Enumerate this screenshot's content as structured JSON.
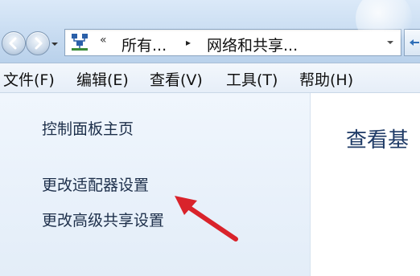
{
  "address_bar": {
    "overflow_chevron": "«",
    "crumbs": [
      "所有...",
      "网络和共享..."
    ],
    "separator": "▸"
  },
  "menu": {
    "file": "文件(F)",
    "edit": "编辑(E)",
    "view": "查看(V)",
    "tools": "工具(T)",
    "help": "帮助(H)"
  },
  "left_pane": {
    "home": "控制面板主页",
    "change_adapter": "更改适配器设置",
    "change_sharing": "更改高级共享设置"
  },
  "right_pane": {
    "heading": "查看基"
  },
  "colors": {
    "annotation_arrow": "#d9232b",
    "link_text": "#1d2f4a",
    "heading_text": "#1e3a66"
  },
  "icons": {
    "back": "back-arrow-icon",
    "forward": "forward-arrow-icon",
    "network": "network-icon",
    "refresh": "refresh-icon"
  }
}
